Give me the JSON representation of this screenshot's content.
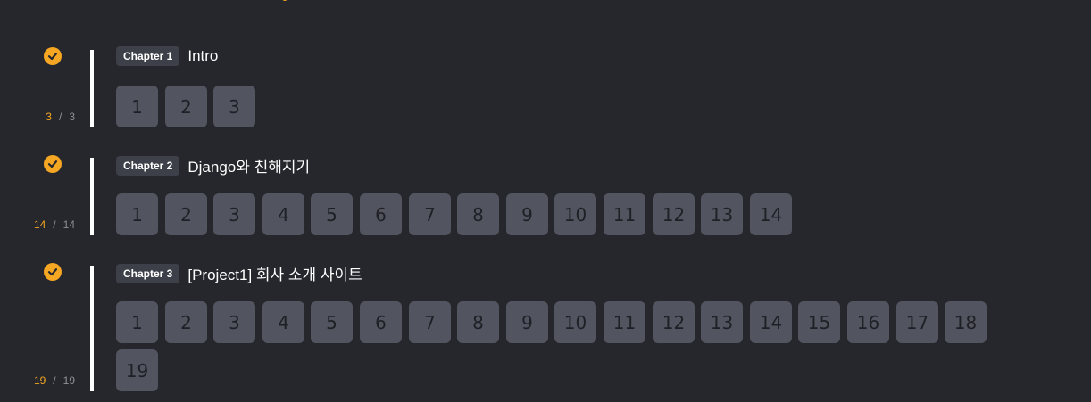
{
  "chapters": [
    {
      "tag": "Chapter 1",
      "title": "Intro",
      "completed": "3",
      "total": "3",
      "units": [
        "1",
        "2",
        "3"
      ]
    },
    {
      "tag": "Chapter 2",
      "title": "Django와 친해지기",
      "completed": "14",
      "total": "14",
      "units": [
        "1",
        "2",
        "3",
        "4",
        "5",
        "6",
        "7",
        "8",
        "9",
        "10",
        "11",
        "12",
        "13",
        "14"
      ]
    },
    {
      "tag": "Chapter 3",
      "title": "[Project1] 회사 소개 사이트",
      "completed": "19",
      "total": "19",
      "units": [
        "1",
        "2",
        "3",
        "4",
        "5",
        "6",
        "7",
        "8",
        "9",
        "10",
        "11",
        "12",
        "13",
        "14",
        "15",
        "16",
        "17",
        "18",
        "19"
      ]
    }
  ],
  "progress_separator": "/",
  "colors": {
    "accent": "#f5a623",
    "background": "#26272c",
    "unit_bg": "#525560",
    "tag_bg": "#3d4049"
  }
}
